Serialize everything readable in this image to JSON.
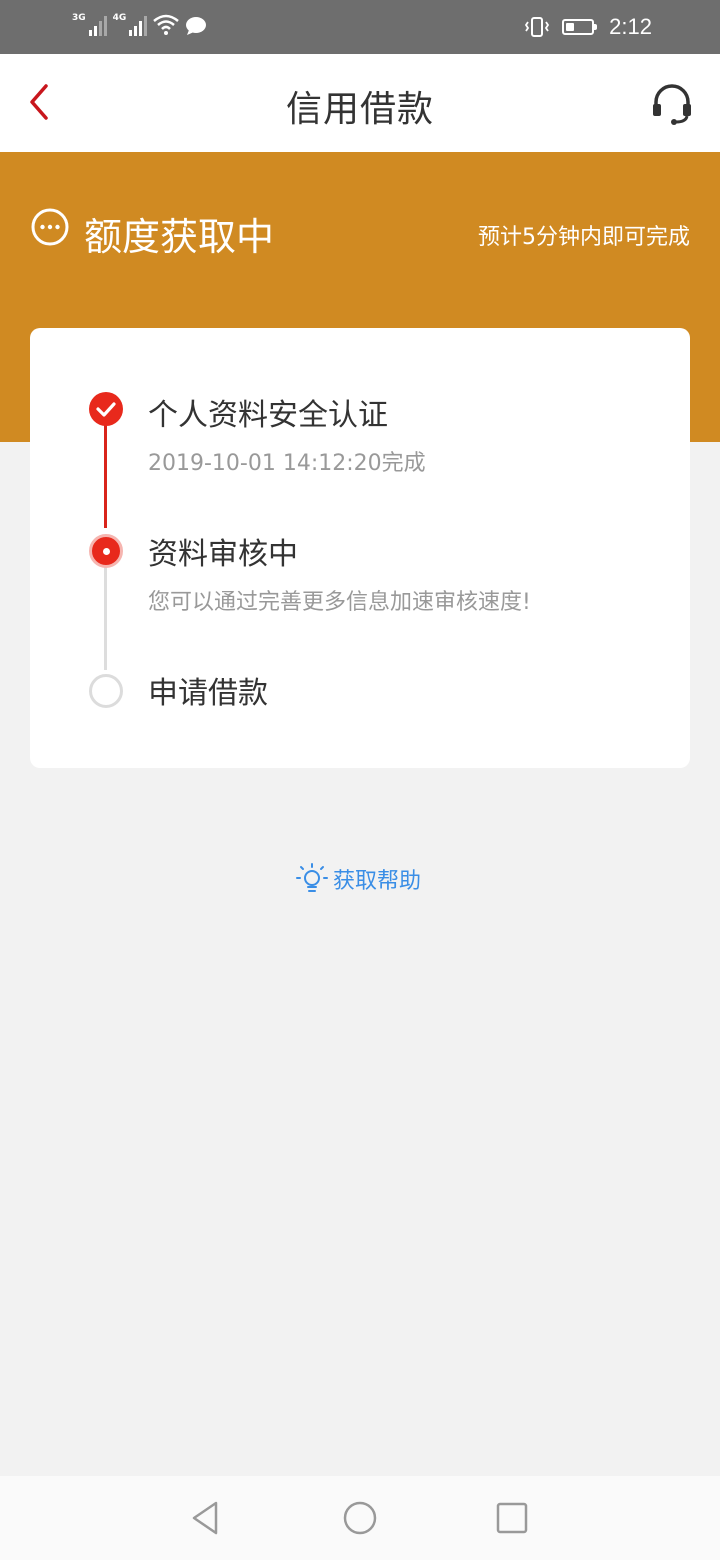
{
  "status_bar": {
    "network_1": "3G",
    "network_2": "4G",
    "time": "2:12",
    "battery_level": 0.35,
    "icons": [
      "signal-icon",
      "wifi-icon",
      "message-icon",
      "vibrate-icon",
      "battery-icon"
    ]
  },
  "header": {
    "title": "信用借款",
    "back_icon": "chevron-left-icon",
    "service_icon": "headset-icon"
  },
  "banner": {
    "status_title": "额度获取中",
    "status_hint": "预计5分钟内即可完成",
    "status_icon": "more-circle-icon"
  },
  "steps": [
    {
      "title": "个人资料安全认证",
      "subtitle": "2019-10-01 14:12:20完成",
      "state": "done"
    },
    {
      "title": "资料审核中",
      "subtitle": "您可以通过完善更多信息加速审核速度!",
      "state": "active"
    },
    {
      "title": "申请借款",
      "state": "pending"
    }
  ],
  "help": {
    "label": "获取帮助",
    "icon": "lightbulb-icon"
  },
  "colors": {
    "accent_red": "#e8291c",
    "banner_orange": "#d08a22",
    "link_blue": "#3a8ee6"
  }
}
